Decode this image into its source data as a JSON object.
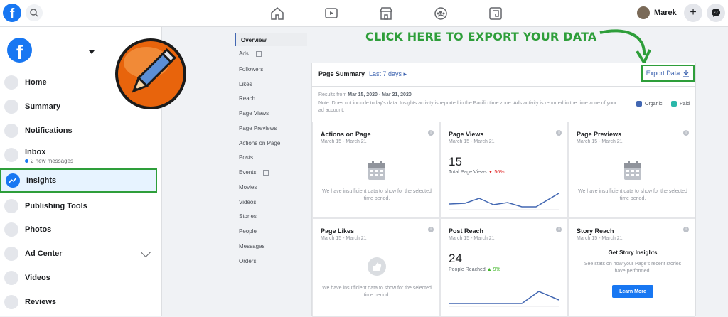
{
  "topbar": {
    "user_name": "Marek"
  },
  "sidebar": {
    "items": [
      {
        "label": "Home"
      },
      {
        "label": "Summary"
      },
      {
        "label": "Notifications"
      },
      {
        "label": "Inbox",
        "sub": "2 new messages"
      },
      {
        "label": "Insights"
      },
      {
        "label": "Publishing Tools"
      },
      {
        "label": "Photos"
      },
      {
        "label": "Ad Center"
      },
      {
        "label": "Videos"
      },
      {
        "label": "Reviews"
      }
    ]
  },
  "subnav": [
    "Overview",
    "Ads",
    "Followers",
    "Likes",
    "Reach",
    "Page Views",
    "Page Previews",
    "Actions on Page",
    "Posts",
    "Events",
    "Movies",
    "Videos",
    "Stories",
    "People",
    "Messages",
    "Orders"
  ],
  "callout": "CLICK HERE TO EXPORT YOUR DATA",
  "summary": {
    "title": "Page Summary",
    "range": "Last 7 days ▸",
    "export_label": "Export Data",
    "results_prefix": "Results from ",
    "results_dates": "Mar 15, 2020 - Mar 21, 2020",
    "note": "Note: Does not include today's data. Insights activity is reported in the Pacific time zone. Ads activity is reported in the time zone of your ad account.",
    "legend_organic": "Organic",
    "legend_paid": "Paid",
    "colors": {
      "organic": "#4267b2",
      "paid": "#2ab7a9",
      "highlight": "#2e9e3a"
    }
  },
  "cards": {
    "date_range": "March 15 - March 21",
    "insufficient": "We have insufficient data to show for the selected time period.",
    "actions": {
      "title": "Actions on Page"
    },
    "page_views": {
      "title": "Page Views",
      "value": "15",
      "label": "Total Page Views",
      "change": "▼ 56%"
    },
    "page_previews": {
      "title": "Page Previews"
    },
    "page_likes": {
      "title": "Page Likes"
    },
    "post_reach": {
      "title": "Post Reach",
      "value": "24",
      "label": "People Reached",
      "change": "▲ 9%"
    },
    "story_reach": {
      "title": "Story Reach",
      "heading": "Get Story Insights",
      "text": "See stats on how your Page's recent stories have performed.",
      "button": "Learn More"
    }
  }
}
